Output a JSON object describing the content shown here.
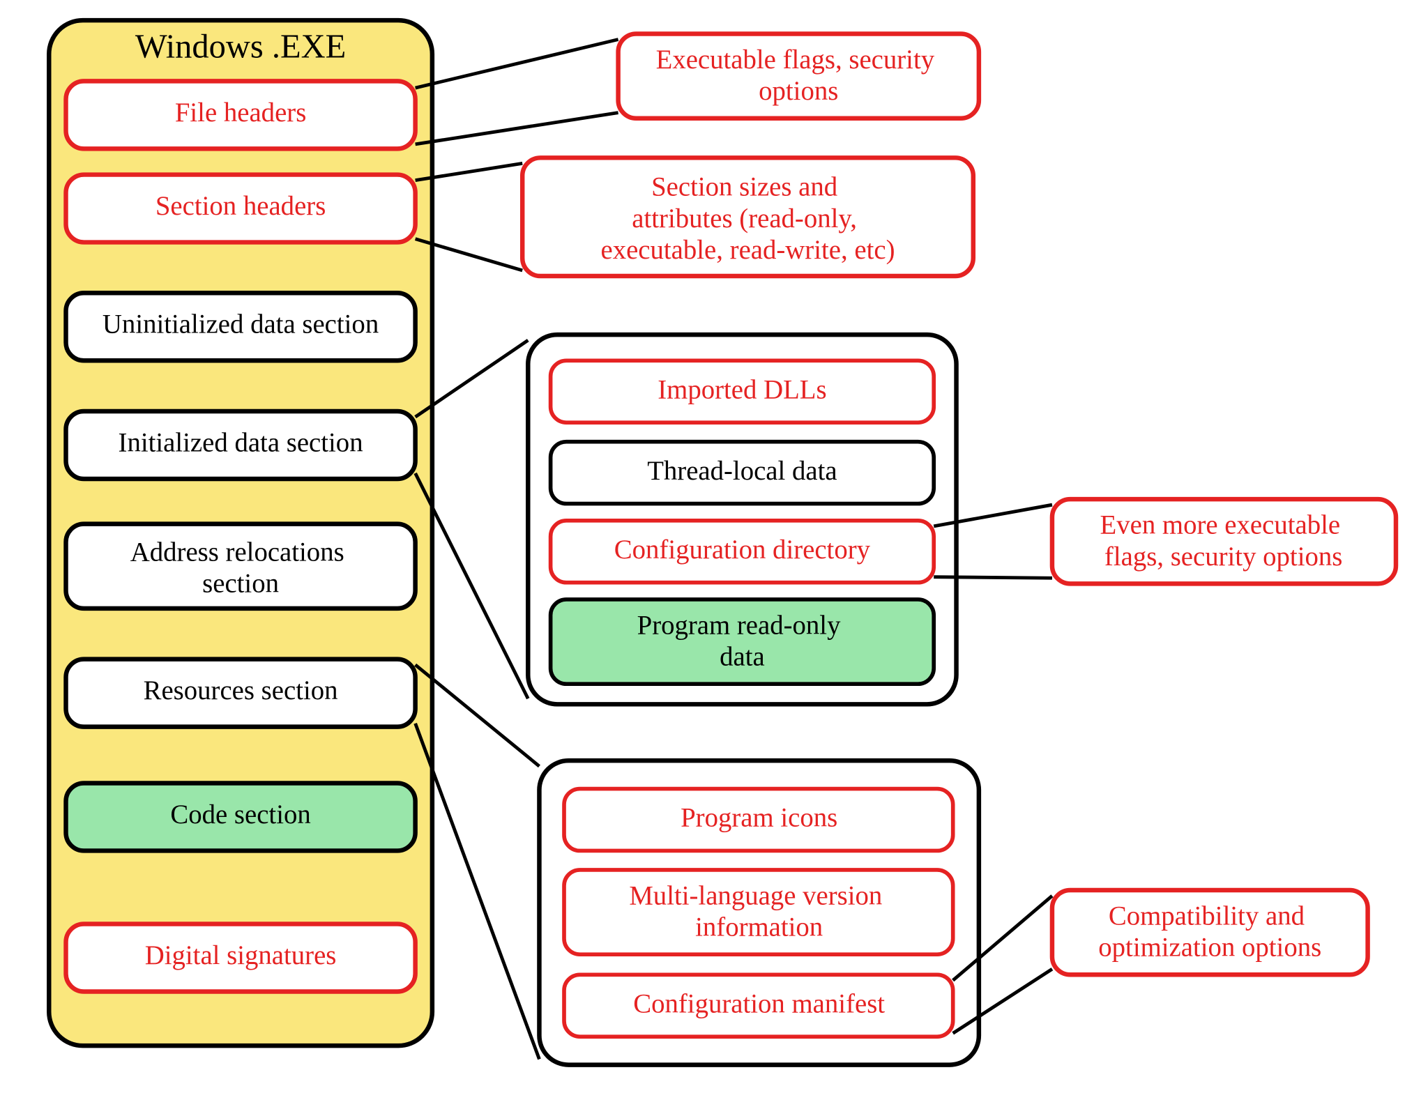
{
  "container_title": "Windows .EXE",
  "sections": {
    "file_headers": {
      "label": "File headers",
      "color": "red",
      "fill": "white"
    },
    "section_headers": {
      "label": "Section headers",
      "color": "red",
      "fill": "white"
    },
    "uninit_data": {
      "label": "Uninitialized data section",
      "color": "black",
      "fill": "white"
    },
    "init_data": {
      "label": "Initialized data section",
      "color": "black",
      "fill": "white"
    },
    "addr_reloc": {
      "label": "Address relocations section",
      "color": "black",
      "fill": "white"
    },
    "resources": {
      "label": "Resources section",
      "color": "black",
      "fill": "white"
    },
    "code": {
      "label": "Code section",
      "color": "black",
      "fill": "green"
    },
    "signatures": {
      "label": "Digital signatures",
      "color": "red",
      "fill": "white"
    }
  },
  "callouts": {
    "file_headers_desc": "Executable flags, security options",
    "section_headers_desc": "Section sizes and attributes (read-only, executable, read-write, etc)",
    "config_dir_desc": "Even more executable flags, security options",
    "manifest_desc": "Compatibility and optimization options"
  },
  "init_data_detail": {
    "imported_dlls": {
      "label": "Imported DLLs",
      "color": "red",
      "fill": "white"
    },
    "thread_local": {
      "label": "Thread-local data",
      "color": "black",
      "fill": "white"
    },
    "config_dir": {
      "label": "Configuration directory",
      "color": "red",
      "fill": "white"
    },
    "ro_data": {
      "label": "Program read-only data",
      "color": "black",
      "fill": "green"
    }
  },
  "resources_detail": {
    "icons": {
      "label": "Program icons",
      "color": "red",
      "fill": "white"
    },
    "version_info": {
      "label": "Multi-language version information",
      "color": "red",
      "fill": "white"
    },
    "manifest": {
      "label": "Configuration manifest",
      "color": "red",
      "fill": "white"
    }
  }
}
